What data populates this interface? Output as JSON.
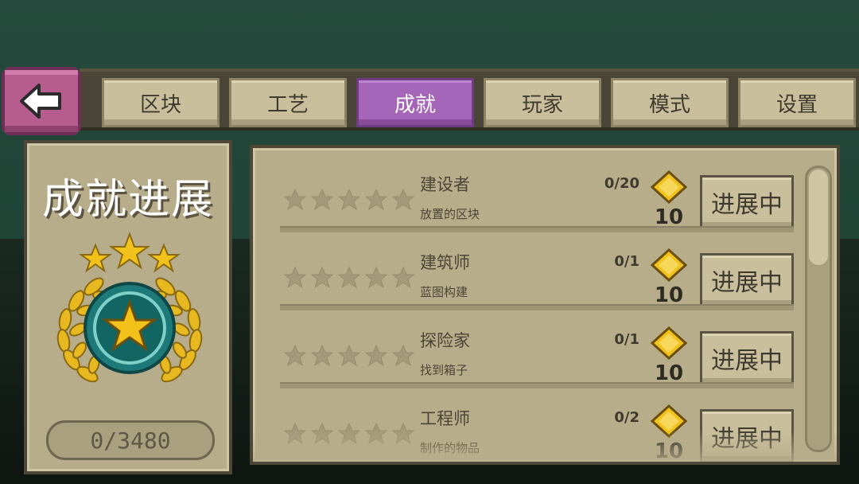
{
  "tabs": [
    {
      "label": "区块"
    },
    {
      "label": "工艺"
    },
    {
      "label": "成就"
    },
    {
      "label": "玩家"
    },
    {
      "label": "模式"
    },
    {
      "label": "设置"
    }
  ],
  "active_tab": "成就",
  "left_panel": {
    "title": "成就进展",
    "score": "0/3480",
    "medal_stars": 3
  },
  "achievements": [
    {
      "name": "建设者",
      "desc": "放置的区块",
      "progress": "0/20",
      "reward": "10",
      "status": "进展中",
      "stars_filled": 0,
      "stars_total": 5
    },
    {
      "name": "建筑师",
      "desc": "蓝图构建",
      "progress": "0/1",
      "reward": "10",
      "status": "进展中",
      "stars_filled": 0,
      "stars_total": 5
    },
    {
      "name": "探险家",
      "desc": "找到箱子",
      "progress": "0/1",
      "reward": "10",
      "status": "进展中",
      "stars_filled": 0,
      "stars_total": 5
    },
    {
      "name": "工程师",
      "desc": "制作的物品",
      "progress": "0/2",
      "reward": "10",
      "status": "进展中",
      "stars_filled": 0,
      "stars_total": 5
    }
  ],
  "icons": {
    "back": "back-arrow-icon",
    "gem": "gold-diamond-icon",
    "star_empty": "empty-star-icon",
    "medal": "laurel-medal-icon"
  },
  "colors": {
    "active_tab": "#a565b8",
    "back_button": "#b65c8f",
    "panel": "#b8ad8b",
    "gem": "#f2c21b"
  }
}
